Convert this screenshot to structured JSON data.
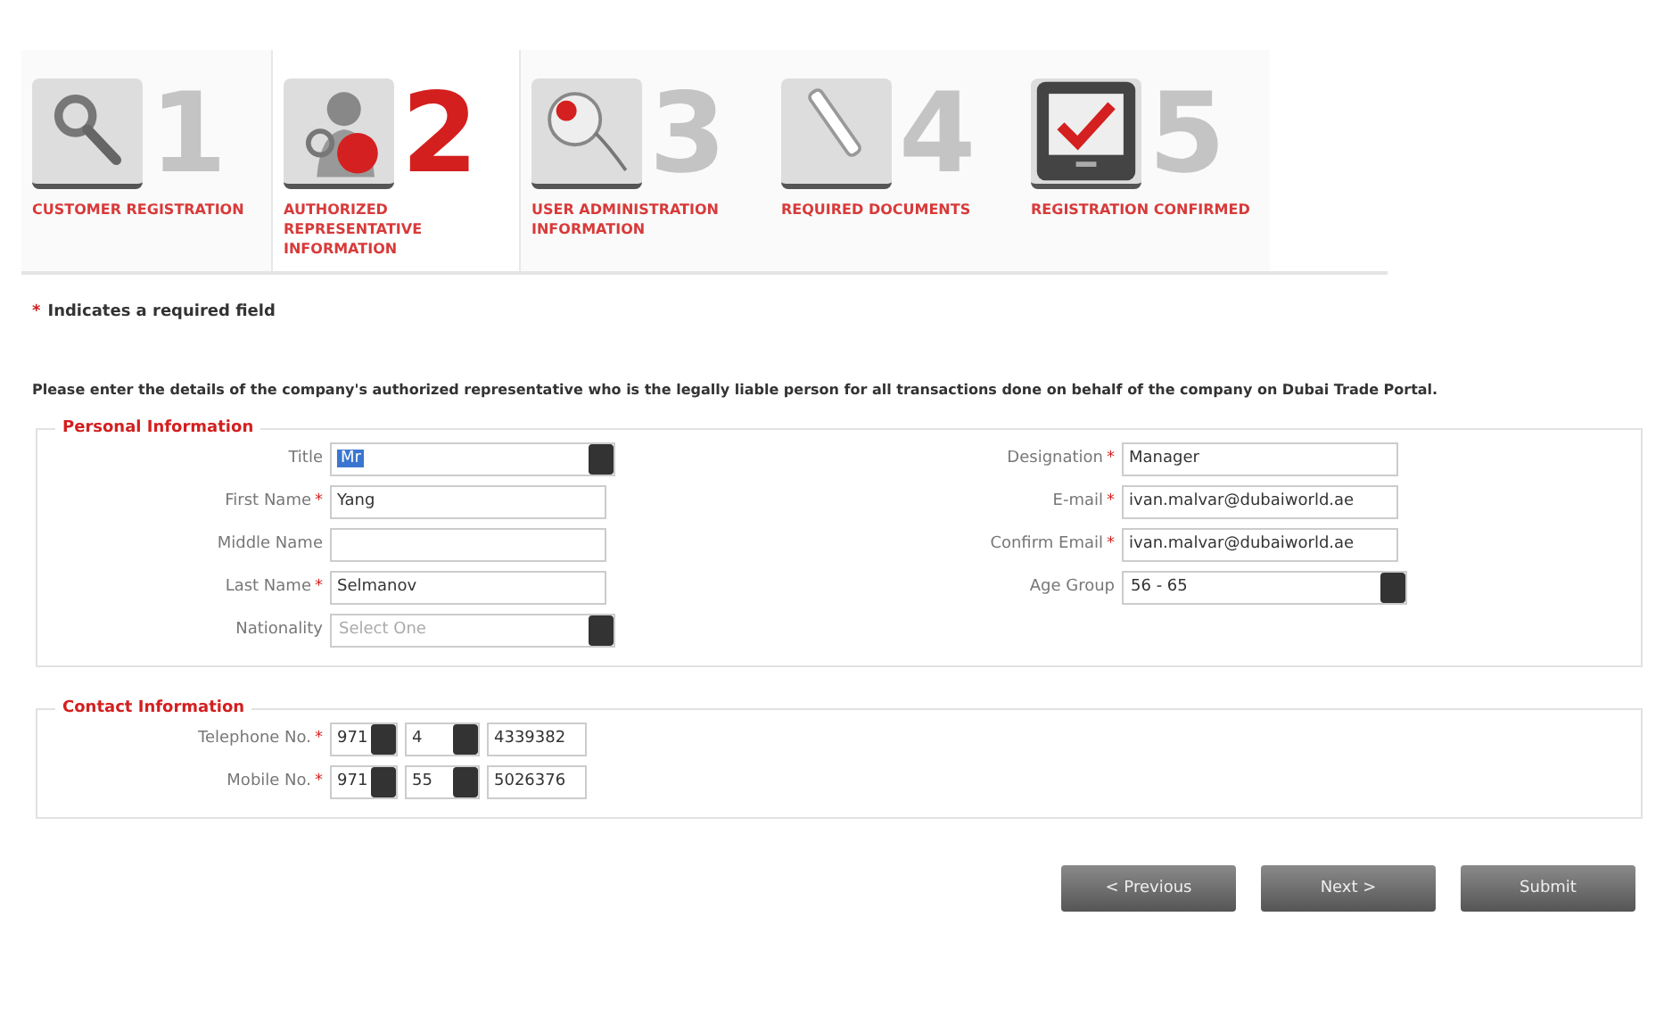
{
  "steps": [
    {
      "number": "1",
      "label": "CUSTOMER REGISTRATION",
      "selected": false
    },
    {
      "number": "2",
      "label": "AUTHORIZED REPRESENTATIVE INFORMATION",
      "selected": true
    },
    {
      "number": "3",
      "label": "USER ADMINISTRATION INFORMATION",
      "selected": false
    },
    {
      "number": "4",
      "label": "REQUIRED DOCUMENTS",
      "selected": false
    },
    {
      "number": "5",
      "label": "REGISTRATION CONFIRMED",
      "selected": false
    }
  ],
  "required_note": {
    "mark": "*",
    "text": "Indicates a required field"
  },
  "intro": "Please enter the details of the company's authorized representative who is the legally liable person for all transactions done on behalf of the company on Dubai Trade Portal.",
  "personal": {
    "legend": "Personal Information",
    "left": [
      {
        "label": "Title",
        "kind": "select",
        "value": "Mr"
      },
      {
        "label": "First Name",
        "required_mark": "*",
        "kind": "text",
        "value": "Yang"
      },
      {
        "label": "Middle Name",
        "kind": "text"
      },
      {
        "label": "Last Name",
        "required_mark": "*",
        "kind": "text",
        "value": "Selmanov"
      },
      {
        "label": "Nationality",
        "kind": "select",
        "placeholder": "Select One"
      }
    ],
    "right": [
      {
        "label": "Designation",
        "required_mark": "*",
        "kind": "text",
        "value": "Manager"
      },
      {
        "label": "E-mail",
        "required_mark": "*",
        "kind": "text",
        "value": "ivan.malvar@dubaiworld.ae"
      },
      {
        "label": "Confirm Email",
        "required_mark": "*",
        "kind": "text",
        "value": "ivan.malvar@dubaiworld.ae"
      },
      {
        "label": "Age Group",
        "kind": "select",
        "value": "56 - 65"
      }
    ]
  },
  "contact": {
    "legend": "Contact Information",
    "rows": [
      {
        "label": "Telephone No.",
        "required_mark": "*",
        "country_code": "971",
        "area_code": "4",
        "number": "4339382"
      },
      {
        "label": "Mobile No.",
        "required_mark": "*",
        "country_code": "971",
        "area_code": "55",
        "number": "5026376"
      }
    ]
  },
  "buttons": [
    "< Previous",
    "Next >",
    "Submit"
  ]
}
